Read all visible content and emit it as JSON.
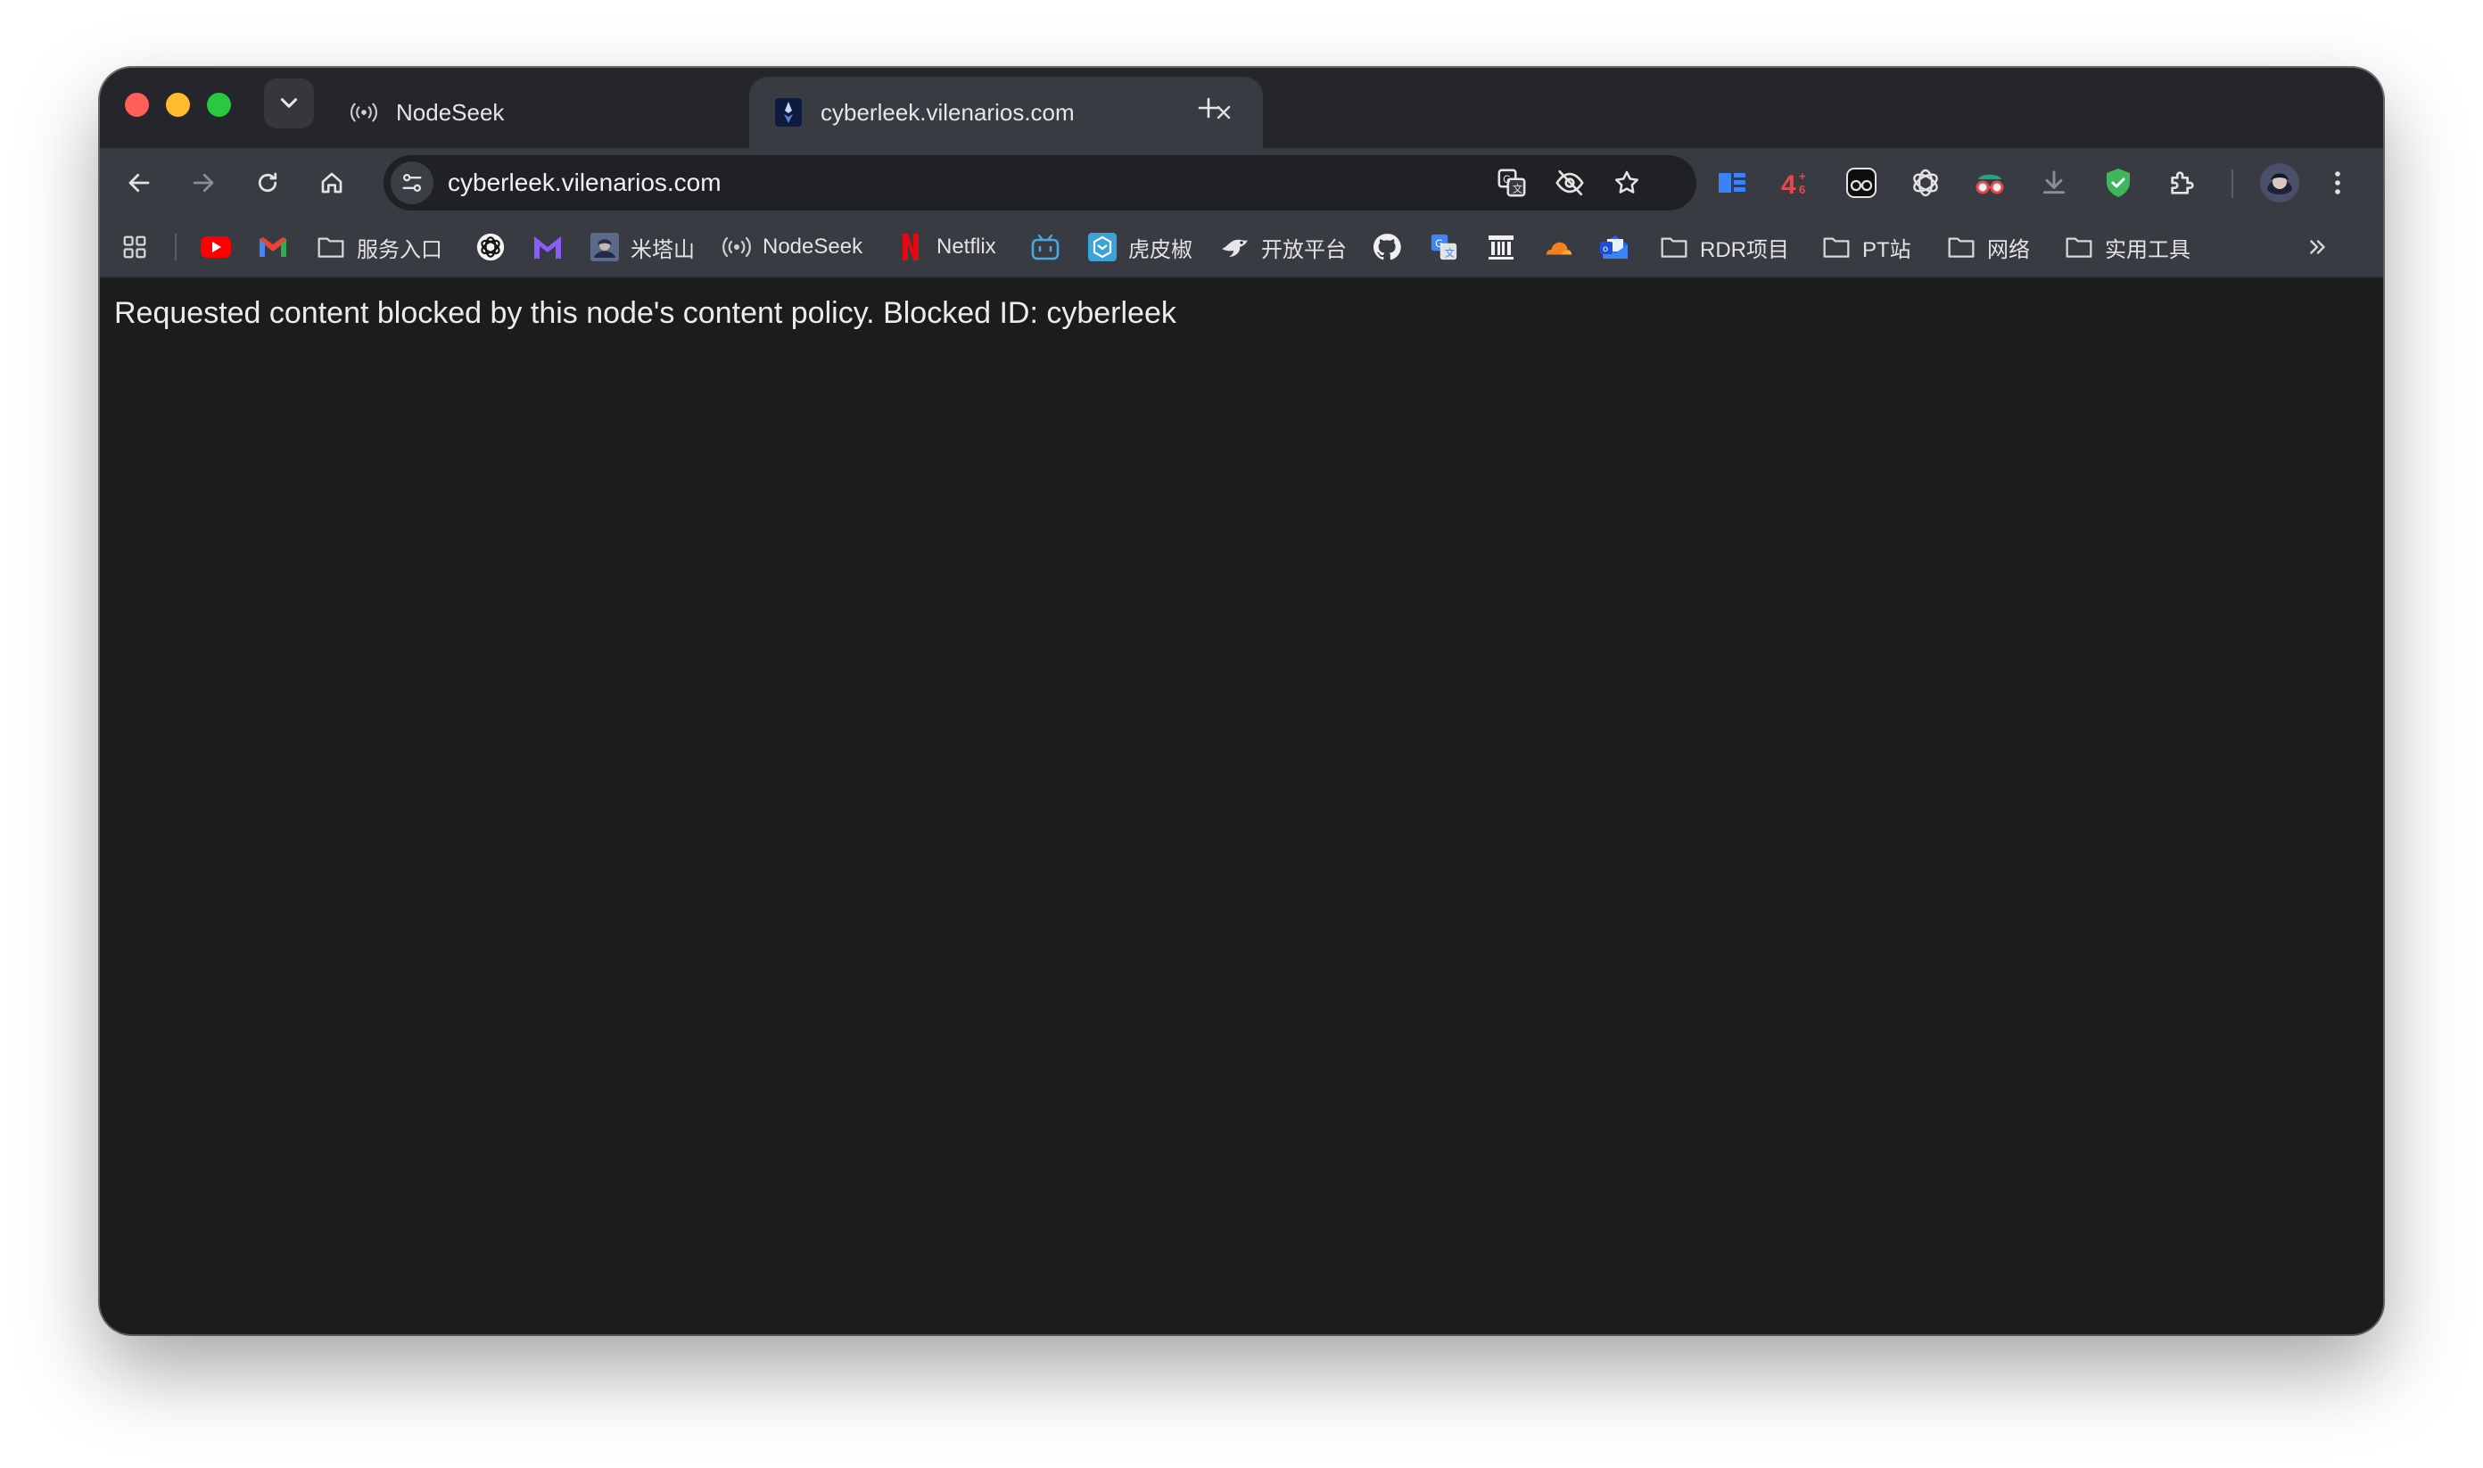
{
  "window": {
    "traffic_lights": [
      "close",
      "minimize",
      "maximize"
    ]
  },
  "tabs": [
    {
      "title": "NodeSeek",
      "favicon": "broadcast-icon",
      "active": false
    },
    {
      "title": "cyberleek.vilenarios.com",
      "favicon": "site-favicon-icon",
      "active": true
    }
  ],
  "toolbar": {
    "url": "cyberleek.vilenarios.com",
    "omnibox_icons": [
      "translate-icon",
      "eye-slash-icon",
      "bookmark-star-icon"
    ],
    "extensions": [
      "reader-icon",
      "counter-extension-icon",
      "glasses-extension-icon",
      "openai-icon",
      "spy-extension-icon",
      "download-icon",
      "shield-icon",
      "puzzle-icon"
    ],
    "counter_badge": "4"
  },
  "bookmarks": [
    {
      "icon": "apps-grid-icon",
      "label": ""
    },
    {
      "icon": "youtube-icon",
      "label": ""
    },
    {
      "icon": "gmail-icon",
      "label": ""
    },
    {
      "icon": "folder-icon",
      "label": "服务入口"
    },
    {
      "icon": "openai-icon",
      "label": ""
    },
    {
      "icon": "m-logo-icon",
      "label": ""
    },
    {
      "icon": "avatar-icon",
      "label": "米塔山"
    },
    {
      "icon": "broadcast-icon",
      "label": "NodeSeek"
    },
    {
      "icon": "netflix-icon",
      "label": "Netflix"
    },
    {
      "icon": "bilibili-icon",
      "label": ""
    },
    {
      "icon": "hupijiao-icon",
      "label": "虎皮椒"
    },
    {
      "icon": "bird-icon",
      "label": "开放平台"
    },
    {
      "icon": "github-icon",
      "label": ""
    },
    {
      "icon": "translate-icon",
      "label": ""
    },
    {
      "icon": "archive-icon",
      "label": ""
    },
    {
      "icon": "cloudflare-icon",
      "label": ""
    },
    {
      "icon": "mail-app-icon",
      "label": ""
    },
    {
      "icon": "folder-icon",
      "label": "RDR项目"
    },
    {
      "icon": "folder-icon",
      "label": "PT站"
    },
    {
      "icon": "folder-icon",
      "label": "网络"
    },
    {
      "icon": "folder-icon",
      "label": "实用工具"
    }
  ],
  "page": {
    "message": "Requested content blocked by this node's content policy. Blocked ID: cyberleek"
  },
  "colors": {
    "titlebar": "#24262c",
    "toolbar": "#383b42",
    "content": "#1b1c1e",
    "close": "#fe5f57",
    "minimize": "#febc2e",
    "maximize": "#28c840"
  }
}
